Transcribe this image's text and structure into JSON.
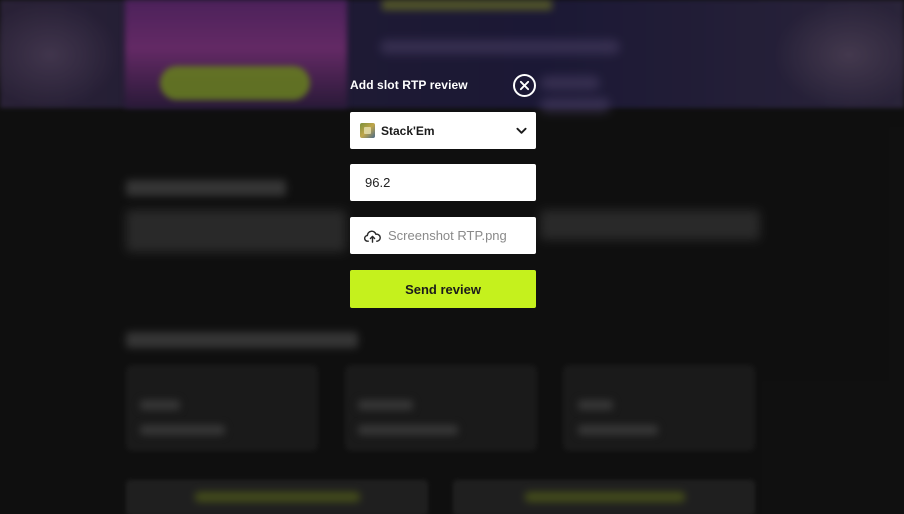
{
  "modal": {
    "title": "Add slot RTP review",
    "close_icon": "close-circle-icon",
    "slot_select": {
      "selected": "Stack'Em",
      "icon": "slot-thumbnail-icon",
      "chevron_icon": "chevron-down-icon"
    },
    "rtp_input": {
      "value": "96.2"
    },
    "upload": {
      "icon": "cloud-upload-icon",
      "file_name": "Screenshot RTP.png"
    },
    "send_button": {
      "label": "Send review"
    }
  },
  "colors": {
    "page_background": "#161616",
    "accent": "#c5f11d",
    "field_background": "#ffffff",
    "modal_text": "#ffffff"
  }
}
